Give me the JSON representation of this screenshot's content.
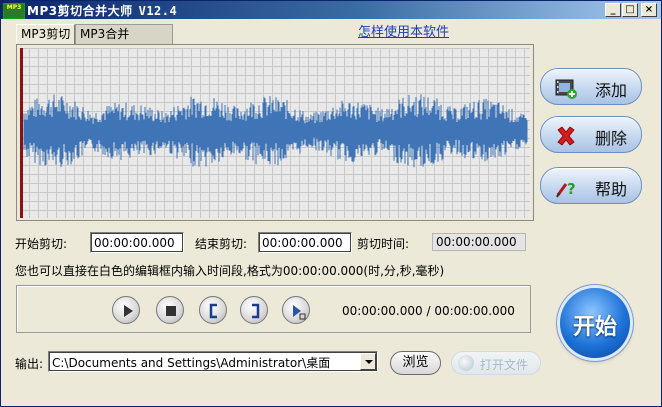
{
  "window": {
    "app_icon_text": "MP3",
    "title": "MP3剪切合并大师",
    "version": "V12.4",
    "controls": {
      "minimize": "_",
      "maximize": "□",
      "close": "×"
    }
  },
  "tabs": [
    {
      "label": "MP3剪切",
      "active": true
    },
    {
      "label": "MP3合并",
      "active": false
    }
  ],
  "help_link": "怎样使用本软件",
  "side_buttons": {
    "add": {
      "label": "添加",
      "icon": "film-add-icon"
    },
    "delete": {
      "label": "删除",
      "icon": "red-x-icon"
    },
    "help": {
      "label": "帮助",
      "icon": "help-question-icon"
    }
  },
  "cut": {
    "start_label": "开始剪切:",
    "start_value": "00:00:00.000",
    "end_label": "结束剪切:",
    "end_value": "00:00:00.000",
    "duration_label": "剪切时间:",
    "duration_value": "00:00:00.000"
  },
  "hint": "您也可以直接在白色的编辑框内输入时间段,格式为00:00:00.000(时,分,秒,毫秒)",
  "player": {
    "buttons": [
      "play-icon",
      "stop-icon",
      "mark-start-icon",
      "mark-end-icon",
      "play-selection-icon"
    ],
    "position": "00:00:00.000",
    "separator": "/",
    "total": "00:00:00.000"
  },
  "start_button": "开始",
  "output": {
    "label": "输出:",
    "path": "C:\\Documents and Settings\\Administrator\\桌面",
    "browse": "浏览",
    "open": "打开文件"
  },
  "colors": {
    "waveform": "#3f74b6",
    "cursor": "#8b1010",
    "title_bar": "#0a246a"
  }
}
